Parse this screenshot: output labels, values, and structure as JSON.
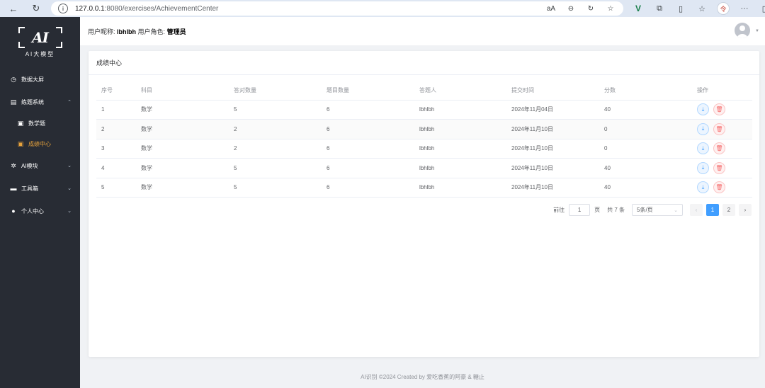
{
  "browser": {
    "url_host": "127.0.0.1",
    "url_path": ":8080/exercises/AchievementCenter",
    "tools": [
      "aA",
      "⊖",
      "↻",
      "☆"
    ],
    "profile_initial": "令"
  },
  "logo": {
    "mark": "AI",
    "text": "AI大模型"
  },
  "sidebar": {
    "items": [
      {
        "label": "数据大屏",
        "icon": "dashboard-icon",
        "glyph": "◷"
      },
      {
        "label": "练题系统",
        "icon": "document-icon",
        "glyph": "▤",
        "arrow": "⌃"
      },
      {
        "label": "数学题",
        "icon": "file-icon",
        "glyph": "▣"
      },
      {
        "label": "成绩中心",
        "icon": "file-icon",
        "glyph": "▣"
      },
      {
        "label": "AI模块",
        "icon": "gear-icon",
        "glyph": "✲",
        "arrow": "⌄"
      },
      {
        "label": "工具箱",
        "icon": "toolbox-icon",
        "glyph": "▬",
        "arrow": "⌄"
      },
      {
        "label": "个人中心",
        "icon": "user-icon",
        "glyph": "●",
        "arrow": "⌄"
      }
    ]
  },
  "header": {
    "nickname_label": "用户昵称:",
    "nickname": "lbhlbh",
    "role_label": "用户角色:",
    "role": "管理员"
  },
  "card": {
    "title": "成绩中心"
  },
  "table": {
    "columns": [
      "序号",
      "科目",
      "答对数量",
      "题目数量",
      "答题人",
      "提交时间",
      "分数",
      "操作"
    ],
    "rows": [
      [
        "1",
        "数学",
        "5",
        "6",
        "lbhlbh",
        "2024年11月04日",
        "40"
      ],
      [
        "2",
        "数学",
        "2",
        "6",
        "lbhlbh",
        "2024年11月10日",
        "0"
      ],
      [
        "3",
        "数学",
        "2",
        "6",
        "lbhlbh",
        "2024年11月10日",
        "0"
      ],
      [
        "4",
        "数学",
        "5",
        "6",
        "lbhlbh",
        "2024年11月10日",
        "40"
      ],
      [
        "5",
        "数学",
        "5",
        "6",
        "lbhlbh",
        "2024年11月10日",
        "40"
      ]
    ]
  },
  "pagination": {
    "goto_label": "前往",
    "page_value": "1",
    "page_unit": "页",
    "total": "共 7 条",
    "page_size": "5条/页",
    "prev": "‹",
    "next": "›",
    "pages": [
      "1",
      "2"
    ],
    "current": "1"
  },
  "footer": {
    "text": "AI识别 ©2024 Created by 爱吃香蕉的阿豪 & 糖止"
  }
}
